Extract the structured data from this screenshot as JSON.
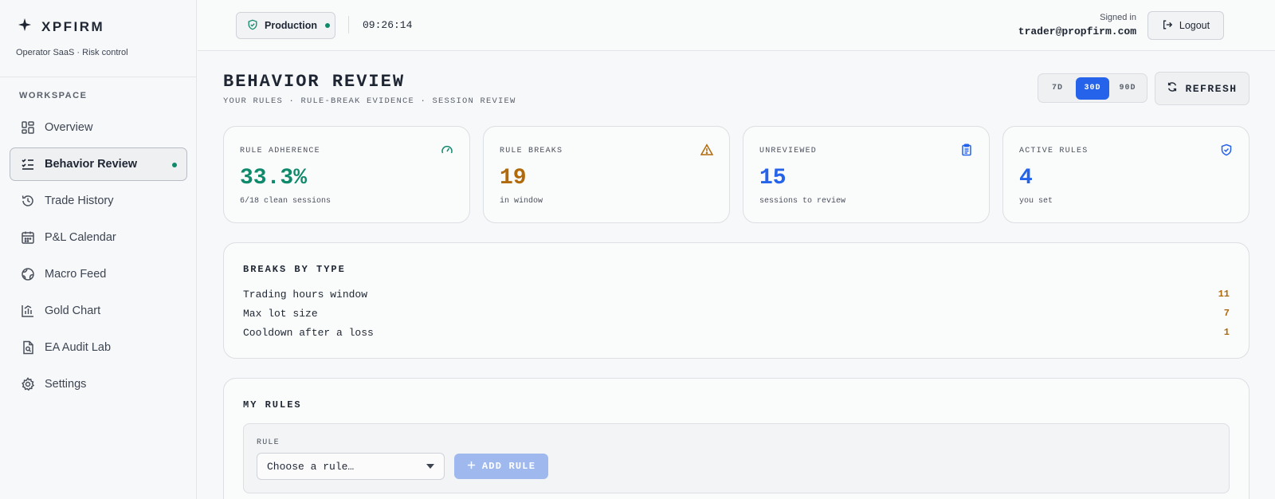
{
  "app": {
    "brand": "XPFIRM",
    "subtitle": "Operator SaaS · Risk control"
  },
  "sidebar": {
    "section_label": "WORKSPACE",
    "items": [
      {
        "label": "Overview",
        "icon": "grid-icon"
      },
      {
        "label": "Behavior Review",
        "icon": "checklist-icon",
        "active": true
      },
      {
        "label": "Trade History",
        "icon": "history-icon"
      },
      {
        "label": "P&L Calendar",
        "icon": "calendar-icon"
      },
      {
        "label": "Macro Feed",
        "icon": "globe-icon"
      },
      {
        "label": "Gold Chart",
        "icon": "chart-icon"
      },
      {
        "label": "EA Audit Lab",
        "icon": "file-search-icon"
      },
      {
        "label": "Settings",
        "icon": "gear-icon"
      }
    ]
  },
  "topbar": {
    "environment": "Production",
    "clock": "09:26:14",
    "signed_in_label": "Signed in",
    "user_email": "trader@propfirm.com",
    "logout_label": "Logout"
  },
  "page": {
    "title": "BEHAVIOR REVIEW",
    "subtitle": "YOUR RULES · RULE-BREAK EVIDENCE · SESSION REVIEW",
    "ranges": [
      "7D",
      "30D",
      "90D"
    ],
    "active_range": "30D",
    "refresh_label": "REFRESH"
  },
  "stats": [
    {
      "label": "RULE ADHERENCE",
      "value": "33.3%",
      "note": "6/18 clean sessions",
      "icon": "gauge-icon",
      "color": "#0f8a6b"
    },
    {
      "label": "RULE BREAKS",
      "value": "19",
      "note": "in window",
      "icon": "warning-icon",
      "color": "#b06a0c"
    },
    {
      "label": "UNREVIEWED",
      "value": "15",
      "note": "sessions to review",
      "icon": "clipboard-icon",
      "color": "#2563eb"
    },
    {
      "label": "ACTIVE RULES",
      "value": "4",
      "note": "you set",
      "icon": "shield-icon",
      "color": "#2563eb"
    }
  ],
  "breaks_by_type": {
    "title": "BREAKS BY TYPE",
    "rows": [
      {
        "label": "Trading hours window",
        "count": "11"
      },
      {
        "label": "Max lot size",
        "count": "7"
      },
      {
        "label": "Cooldown after a loss",
        "count": "1"
      }
    ]
  },
  "my_rules": {
    "title": "MY RULES",
    "rule_label": "RULE",
    "select_placeholder": "Choose a rule…",
    "add_label": "ADD RULE"
  }
}
